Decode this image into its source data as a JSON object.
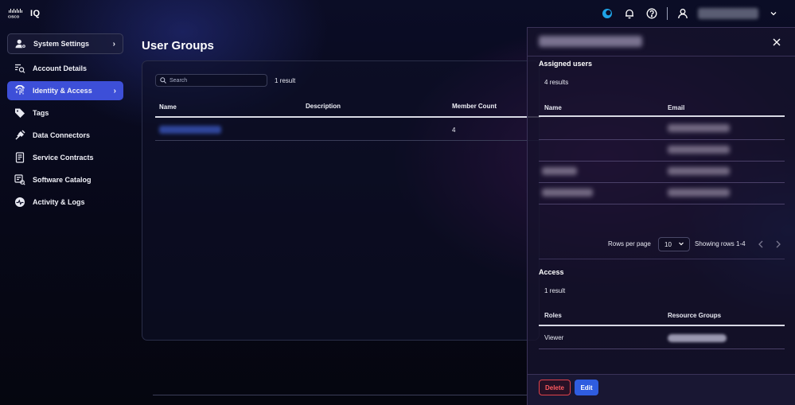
{
  "app": {
    "logo_text": "IQ"
  },
  "sidebar": {
    "items": [
      {
        "label": "System Settings",
        "icon": "user-gear-icon"
      },
      {
        "label": "Account Details",
        "icon": "search-list-icon"
      },
      {
        "label": "Identity & Access",
        "icon": "fingerprint-icon"
      },
      {
        "label": "Tags",
        "icon": "tag-icon"
      },
      {
        "label": "Data Connectors",
        "icon": "plug-icon"
      },
      {
        "label": "Service Contracts",
        "icon": "contract-icon"
      },
      {
        "label": "Software Catalog",
        "icon": "catalog-icon"
      },
      {
        "label": "Activity & Logs",
        "icon": "activity-icon"
      }
    ]
  },
  "main": {
    "title": "User Groups",
    "search_placeholder": "Search",
    "result_count": "1 result",
    "columns": [
      "Name",
      "Description",
      "Member Count"
    ],
    "rows": [
      {
        "member_count": "4"
      }
    ]
  },
  "drawer": {
    "assigned": {
      "title": "Assigned users",
      "count": "4 results",
      "columns": [
        "Name",
        "Email"
      ]
    },
    "pager": {
      "rows_label": "Rows per page",
      "rows_value": "10",
      "showing": "Showing rows 1-4"
    },
    "access": {
      "title": "Access",
      "count": "1 result",
      "columns": [
        "Roles",
        "Resource Groups"
      ],
      "rows": [
        {
          "role": "Viewer"
        }
      ]
    },
    "delete_label": "Delete",
    "edit_label": "Edit"
  },
  "colors": {
    "accent": "#3d4fd8",
    "danger": "#e0424a",
    "primary_button": "#2f5de0"
  }
}
